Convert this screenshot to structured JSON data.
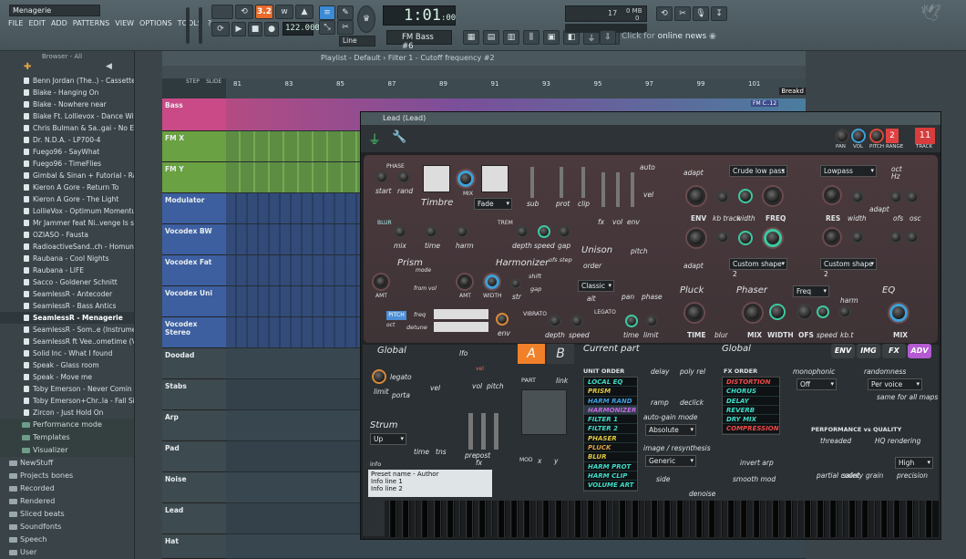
{
  "project_name": "Menagerie",
  "menu": [
    "FILE",
    "EDIT",
    "ADD",
    "PATTERNS",
    "VIEW",
    "OPTIONS",
    "TOOLS",
    "?"
  ],
  "transport": {
    "tempo": "122.000",
    "time": "1:01",
    "time_small": ":00",
    "pattern": "FM Bass #6",
    "snap": "Line",
    "cpu": "17",
    "mem": "0 MB",
    "mem2": "0",
    "news_prefix": "Click for",
    "news": "online news"
  },
  "browser": {
    "title": "Browser - All",
    "items": [
      "Benn Jordan (The..) - Cassette Cafe",
      "Blake - Hanging On",
      "Blake - Nowhere near",
      "Blake Ft. Lollievox - Dance With Me",
      "Chris Bulman & Sa..gai - No Escape",
      "Dr. N.D.A. - LP700-4",
      "Fuego96 - SayWhat",
      "Fuego96 - TimeFlies",
      "Gimbal & Sinan + Futorial - RawFL",
      "Kieron A Gore - Return To",
      "Kieron A Gore - The Light",
      "LollieVox - Optimum Momentum",
      "Mr Jammer feat Ni..venge Is sweet",
      "OZIASO - Fausta",
      "RadioactiveSand..ch - Homunculus",
      "Raubana - Cool Nights",
      "Raubana - LIFE",
      "Sacco - Goldener Schnitt",
      "SeamlessR - Antecoder",
      "SeamlessR - Bass Antics",
      "SeamlessR - Menagerie",
      "SeamlessR - Som..e (Instrumental)",
      "SeamlessR ft Vee..ometime (Vocal)",
      "Solid Inc - What I found",
      "Speak - Glass room",
      "Speak - Move me",
      "Toby Emerson - Never Comin Down",
      "Toby Emerson+Chr..la - Fall Silently",
      "Zircon - Just Hold On"
    ],
    "selected": "SeamlessR - Menagerie",
    "subfolders": [
      "Performance mode",
      "Templates",
      "Visualizer"
    ],
    "folders": [
      "NewStuff",
      "Projects bones",
      "Recorded",
      "Rendered",
      "Sliced beats",
      "Soundfonts",
      "Speech",
      "User"
    ]
  },
  "playlist": {
    "title": "Playlist - Default › Filter 1 - Cutoff frequency #2",
    "bars": [
      "81",
      "83",
      "85",
      "87",
      "89",
      "91",
      "93",
      "95",
      "97",
      "99",
      "101"
    ],
    "marker": "Breakd",
    "step_label": "STEP",
    "slide_label": "SLIDE",
    "tracks": [
      "Bass",
      "FM X",
      "FM Y",
      "Modulator",
      "Vocodex BW",
      "Vocodex Fat",
      "Vocodex Uni",
      "Vocodex Stereo",
      "Doodad",
      "Stabs",
      "Arp",
      "Pad",
      "Noise",
      "Lead",
      "Hat"
    ],
    "clip_label": "FM C..12"
  },
  "plugin": {
    "window_title": "Lead (Lead)",
    "pan_label": "PAN",
    "vol_label": "VOL",
    "pitch_label": "PITCH",
    "range_label": "RANGE",
    "track_label": "TRACK",
    "pitch_value": "2",
    "track_value": "11",
    "labels": {
      "phase": "PHASE",
      "start": "start",
      "rand": "rand",
      "mix": "MIX",
      "timbre": "Timbre",
      "fade": "Fade",
      "sub": "sub",
      "prot": "prot",
      "clip": "clip",
      "auto": "auto",
      "vel": "vel",
      "fx": "fx",
      "vol": "vol",
      "env": "env",
      "blur": "BLUR",
      "mix2": "mix",
      "time": "time",
      "harm": "harm",
      "trem": "TREM",
      "depth": "depth",
      "speed": "speed",
      "gap": "gap",
      "unison": "Unison",
      "order": "order",
      "pitch": "pitch",
      "pan": "pan",
      "phase2": "phase",
      "classic": "Classic",
      "alt": "alt",
      "prism": "Prism",
      "mode": "mode",
      "from_vol": "from vol",
      "amt": "AMT",
      "harmonizer": "Harmonizer",
      "ofs_step": "ofs step",
      "shift": "shift",
      "gap2": "gap",
      "width": "WIDTH",
      "str": "str",
      "pitch_box": "PITCH",
      "freq": "freq",
      "detune": "detune",
      "oct": "oct",
      "vibrato": "VIBRATO",
      "legato": "LEGATO",
      "limit": "limit",
      "adapt": "adapt",
      "crude_low_pass": "Crude low pass",
      "lowpass": "Lowpass",
      "oct2": "oct",
      "hz": "Hz",
      "ENV": "ENV",
      "kb_track": "kb track",
      "width2": "width",
      "FREQ": "FREQ",
      "RES": "RES",
      "width3": "width",
      "ofs": "ofs",
      "osc": "osc",
      "custom_shape_1": "Custom shape 2",
      "custom_shape_2": "Custom shape 2",
      "harm2": "harm",
      "pluck": "Pluck",
      "phaser": "Phaser",
      "freq_dd": "Freq",
      "eq": "EQ",
      "TIME": "TIME",
      "blur2": "blur",
      "MIX": "MIX",
      "WIDTH": "WIDTH",
      "OFS": "OFS",
      "speed2": "speed",
      "kbt": "kb.t",
      "MIX2": "MIX"
    },
    "global": {
      "title": "Global",
      "lfo": "lfo",
      "vel": "vel",
      "legato": "legato",
      "porta": "porta",
      "limit": "limit",
      "vel2": "vel",
      "vol": "vol",
      "pitch": "pitch",
      "strum": "Strum",
      "strum_value": "Up",
      "time": "time",
      "tns": "tns",
      "pre": "pre",
      "post": "post",
      "fx": "fx",
      "info": "info",
      "info_lines": [
        "Preset name - Author",
        "Info line 1",
        "Info line 2"
      ]
    },
    "part": {
      "a": "A",
      "b": "B",
      "part": "PART",
      "link": "link",
      "mod": "MOD",
      "x": "x",
      "y": "y"
    },
    "current_part": {
      "title": "Current part",
      "unit_order_title": "UNIT ORDER",
      "unit_order": [
        "LOCAL EQ",
        "PRISM",
        "HARM RAND",
        "HARMONIZER",
        "FILTER 1",
        "FILTER 2",
        "PHASER",
        "PLUCK",
        "BLUR",
        "HARM PROT",
        "HARM CLIP",
        "VOLUME ART"
      ],
      "delay": "delay",
      "poly_rel": "poly rel",
      "ramp": "ramp",
      "declick": "declick",
      "auto_gain": "auto-gain mode",
      "auto_gain_value": "Absolute",
      "resynth": "image / resynthesis",
      "resynth_value": "Generic",
      "side": "side",
      "denoise": "denoise"
    },
    "global_fx": {
      "title": "Global",
      "fx_order_title": "FX ORDER",
      "fx_order": [
        "DISTORTION",
        "CHORUS",
        "DELAY",
        "REVERB",
        "DRY MIX",
        "COMPRESSION"
      ],
      "invert_arp": "invert arp",
      "smooth_mod": "smooth mod"
    },
    "tabs": [
      "ENV",
      "IMG",
      "FX",
      "ADV"
    ],
    "adv": {
      "monophonic": "monophonic",
      "mono_value": "Off",
      "randomness": "randomness",
      "rand_value": "Per voice",
      "same_for_all": "same for all maps",
      "perf_title": "PERFORMANCE vs QUALITY",
      "threaded": "threaded",
      "hq": "HQ rendering",
      "partial_count": "partial count",
      "safety": "safety",
      "grain": "grain",
      "precision": "precision",
      "precision_value": "High"
    }
  },
  "colors": {
    "accent": "#f0812a",
    "pink": "#d64b93",
    "green_clip": "#8fc76a",
    "purple": "#b45ad2"
  }
}
